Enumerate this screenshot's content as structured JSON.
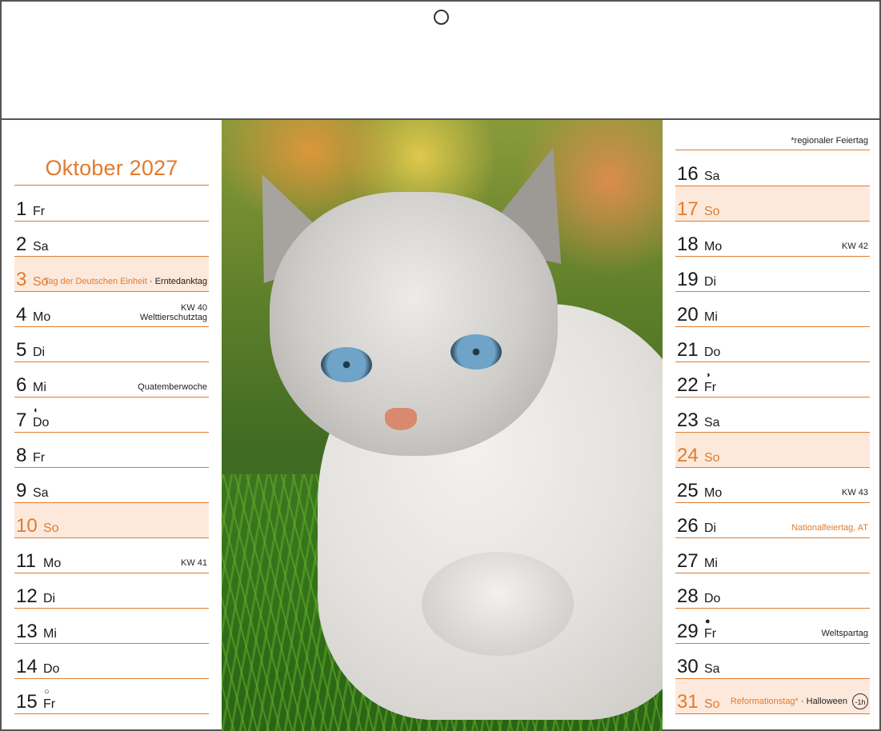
{
  "month_title": "Oktober 2027",
  "footnote": "*regionaler Feiertag",
  "left_days": [
    {
      "num": "1",
      "name": "Fr"
    },
    {
      "num": "2",
      "name": "Sa"
    },
    {
      "num": "3",
      "name": "So",
      "holiday": "Tag der Deutschen Einheit",
      "sep": " · ",
      "extra": "Erntedanktag"
    },
    {
      "num": "4",
      "name": "Mo",
      "line1": "KW 40",
      "line2": "Welttierschutztag"
    },
    {
      "num": "5",
      "name": "Di"
    },
    {
      "num": "6",
      "name": "Mi",
      "line2": "Quatemberwoche"
    },
    {
      "num": "7",
      "name": "Do",
      "moon": "◐"
    },
    {
      "num": "8",
      "name": "Fr"
    },
    {
      "num": "9",
      "name": "Sa"
    },
    {
      "num": "10",
      "name": "So"
    },
    {
      "num": "11",
      "name": "Mo",
      "line2": "KW 41"
    },
    {
      "num": "12",
      "name": "Di"
    },
    {
      "num": "13",
      "name": "Mi"
    },
    {
      "num": "14",
      "name": "Do"
    },
    {
      "num": "15",
      "name": "Fr",
      "moon": "○"
    }
  ],
  "right_days": [
    {
      "num": "16",
      "name": "Sa"
    },
    {
      "num": "17",
      "name": "So"
    },
    {
      "num": "18",
      "name": "Mo",
      "line2": "KW 42"
    },
    {
      "num": "19",
      "name": "Di"
    },
    {
      "num": "20",
      "name": "Mi"
    },
    {
      "num": "21",
      "name": "Do"
    },
    {
      "num": "22",
      "name": "Fr",
      "moon": "◑"
    },
    {
      "num": "23",
      "name": "Sa"
    },
    {
      "num": "24",
      "name": "So"
    },
    {
      "num": "25",
      "name": "Mo",
      "line2": "KW 43"
    },
    {
      "num": "26",
      "name": "Di",
      "holiday": "Nationalfeiertag, AT"
    },
    {
      "num": "27",
      "name": "Mi"
    },
    {
      "num": "28",
      "name": "Do"
    },
    {
      "num": "29",
      "name": "Fr",
      "moon": "●",
      "line2": "Weltspartag"
    },
    {
      "num": "30",
      "name": "Sa"
    },
    {
      "num": "31",
      "name": "So",
      "holiday": "Reformationstag*",
      "sep": " · ",
      "extra": "Halloween",
      "time_icon": "-1h"
    }
  ],
  "colors": {
    "accent": "#e07b2e",
    "sunday_bg": "#fde9dc",
    "text": "#1a1a1a"
  },
  "photo": {
    "subject": "cat-photo"
  }
}
